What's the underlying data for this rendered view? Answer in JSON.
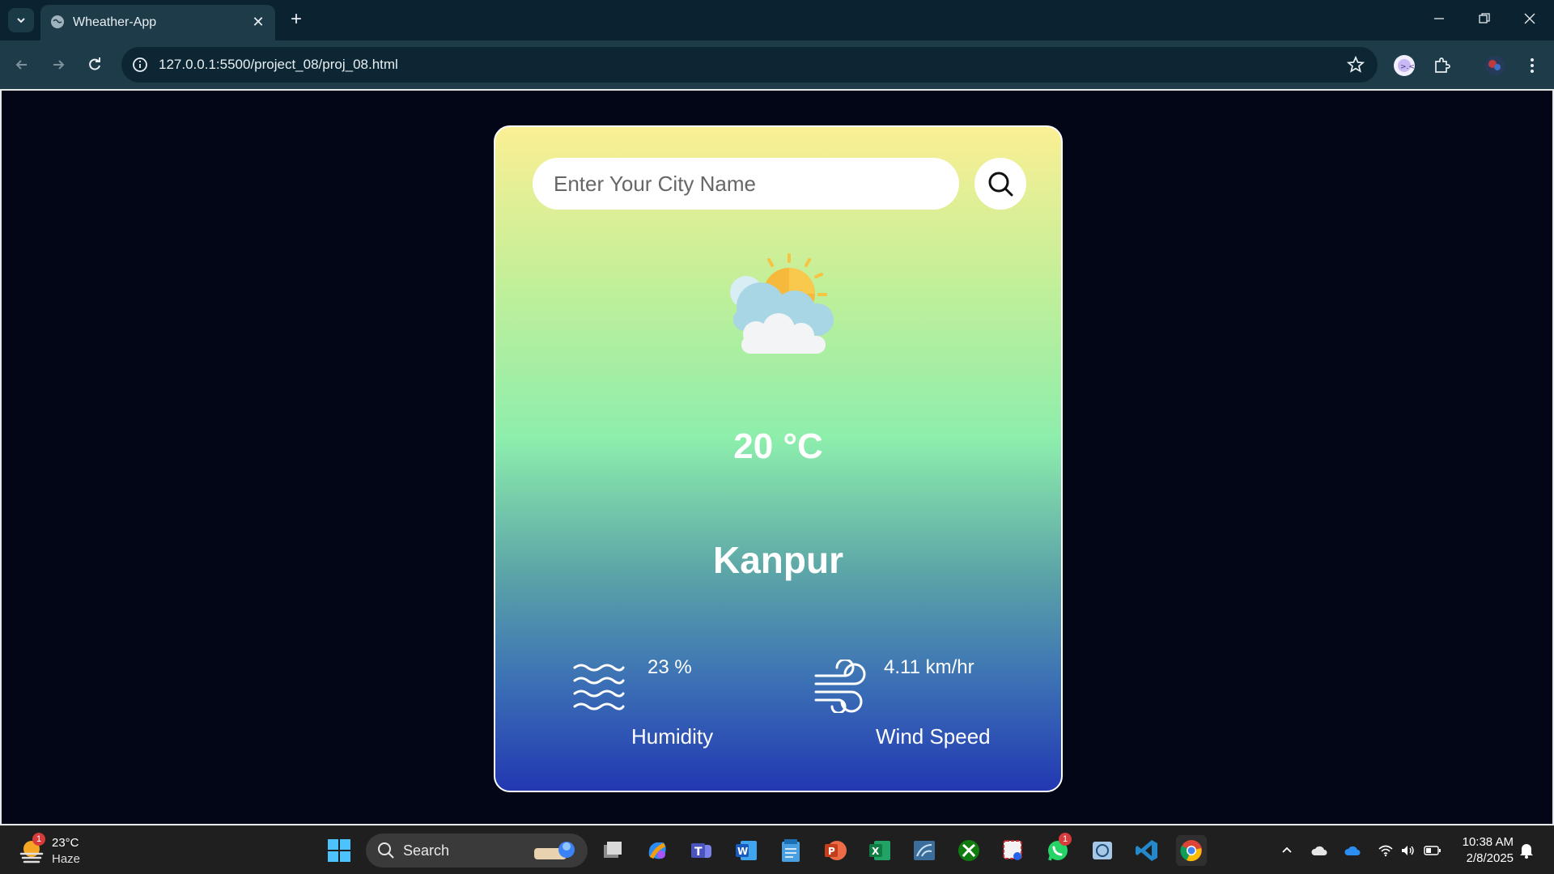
{
  "browser": {
    "tab_title": "Wheather-App",
    "url": "127.0.0.1:5500/project_08/proj_08.html"
  },
  "app": {
    "search_placeholder": "Enter Your City Name",
    "temperature": "20 °C",
    "city": "Kanpur",
    "humidity_value": "23 %",
    "humidity_label": "Humidity",
    "wind_value": "4.11 km/hr",
    "wind_label": "Wind Speed"
  },
  "taskbar": {
    "weather_temp": "23°C",
    "weather_condition": "Haze",
    "weather_badge": "1",
    "search_label": "Search",
    "whatsapp_badge": "1",
    "time": "10:38 AM",
    "date": "2/8/2025"
  },
  "colors": {
    "card_top": "#fbef94",
    "card_middle": "#8deeac",
    "card_bottom": "#2238b2",
    "page_background": "#020617"
  }
}
